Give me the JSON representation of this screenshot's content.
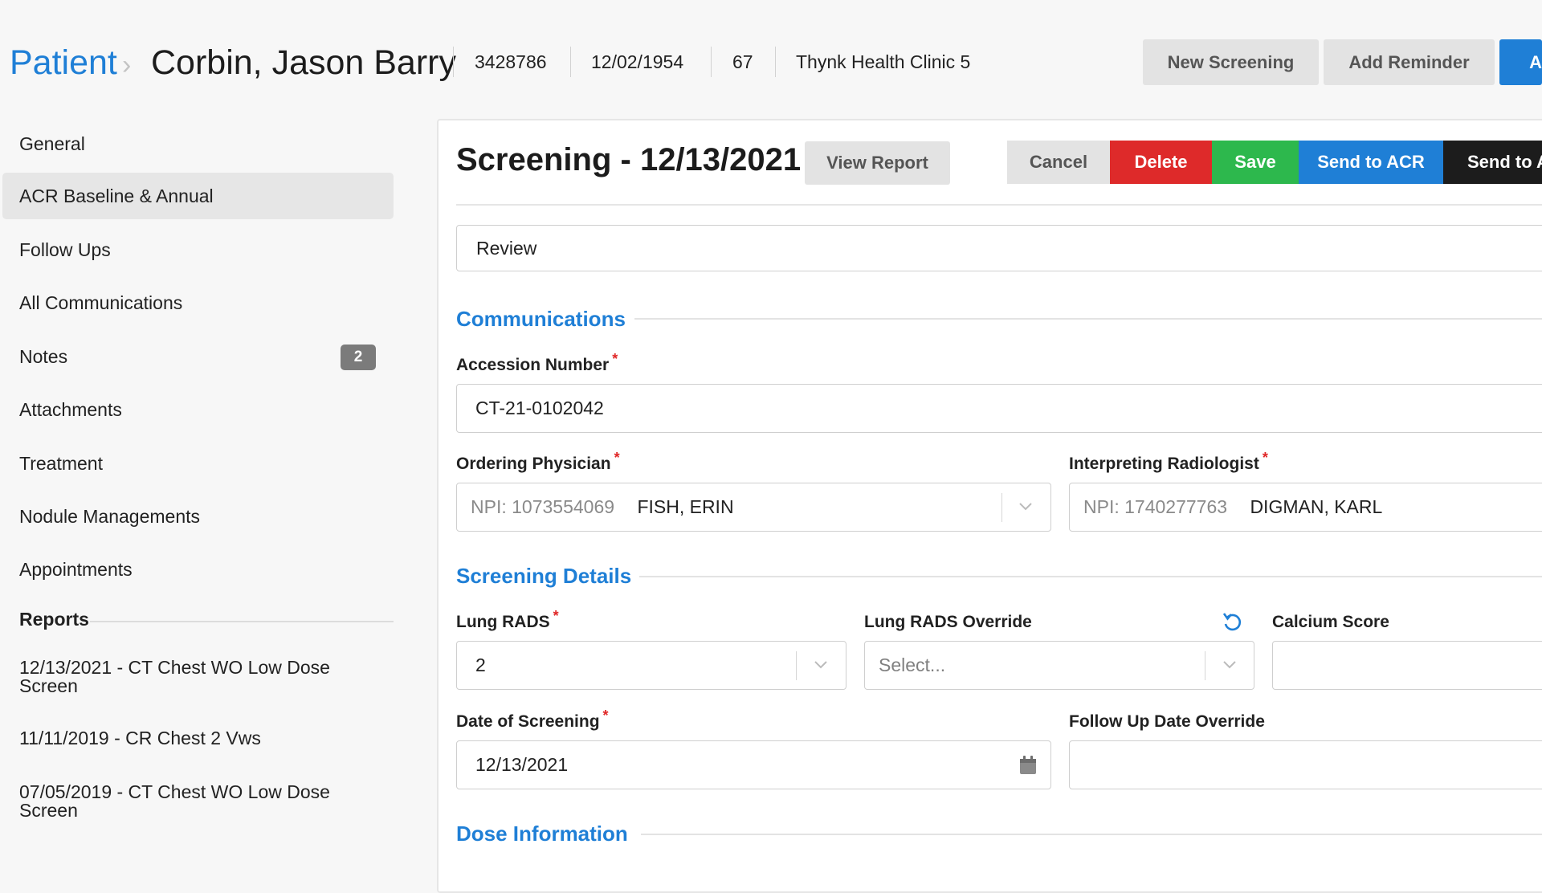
{
  "header": {
    "breadcrumb_root": "Patient",
    "breadcrumb_sep": "›",
    "patient_name": "Corbin, Jason Barry",
    "mrn": "3428786",
    "dob": "12/02/1954",
    "age": "67",
    "clinic": "Thynk Health Clinic 5",
    "buttons": {
      "new_screening": "New Screening",
      "add_reminder": "Add Reminder",
      "third": "A"
    }
  },
  "sidebar": {
    "items": [
      {
        "label": "General",
        "active": false
      },
      {
        "label": "ACR Baseline & Annual",
        "active": true
      },
      {
        "label": "Follow Ups",
        "active": false
      },
      {
        "label": "All Communications",
        "active": false
      },
      {
        "label": "Notes",
        "active": false,
        "badge": "2"
      },
      {
        "label": "Attachments",
        "active": false
      },
      {
        "label": "Treatment",
        "active": false
      },
      {
        "label": "Nodule Managements",
        "active": false
      },
      {
        "label": "Appointments",
        "active": false
      }
    ],
    "reports_title": "Reports",
    "reports": [
      {
        "line1": "12/13/2021 - CT Chest WO Low Dose",
        "line2": "Screen"
      },
      {
        "line1": "11/11/2019 - CR Chest 2 Vws",
        "line2": ""
      },
      {
        "line1": "07/05/2019 - CT Chest WO Low Dose",
        "line2": "Screen"
      }
    ]
  },
  "main": {
    "title": "Screening - 12/13/2021",
    "view_report": "View Report",
    "actions": {
      "cancel": "Cancel",
      "delete": "Delete",
      "save": "Save",
      "send_acr": "Send to ACR",
      "send_acr2": "Send to AC"
    },
    "status": "Review",
    "communications": {
      "title": "Communications",
      "accession_label": "Accession Number",
      "accession_value": "CT-21-0102042",
      "ordering_label": "Ordering Physician",
      "ordering_npi": "NPI: 1073554069",
      "ordering_name": "FISH, ERIN",
      "interpreting_label": "Interpreting Radiologist",
      "interpreting_npi": "NPI: 1740277763",
      "interpreting_name": "DIGMAN, KARL"
    },
    "screening_details": {
      "title": "Screening Details",
      "lung_rads_label": "Lung RADS",
      "lung_rads_value": "2",
      "override_label": "Lung RADS Override",
      "override_placeholder": "Select...",
      "calcium_label": "Calcium Score",
      "date_label": "Date of Screening",
      "date_value": "12/13/2021",
      "followup_label": "Follow Up Date Override"
    },
    "dose": {
      "title": "Dose Information"
    }
  },
  "colors": {
    "accent": "#1f7fd6",
    "delete": "#de2a2a",
    "save": "#2db84d",
    "send": "#1f7fd6",
    "send_dark": "#1c1c1c",
    "required": "#e02727"
  }
}
